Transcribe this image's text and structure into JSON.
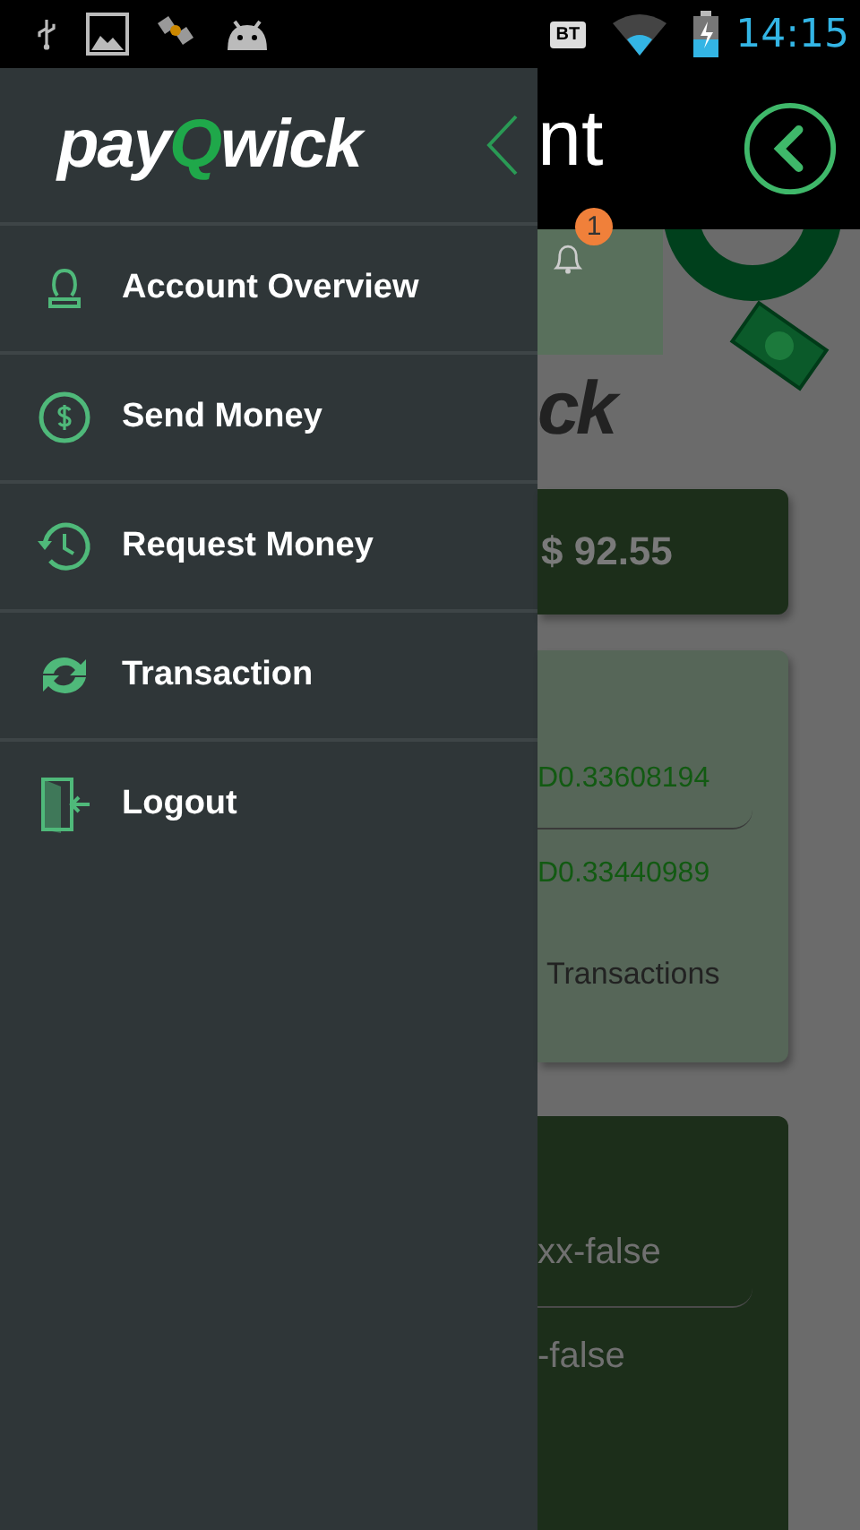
{
  "status_bar": {
    "bt": "BT",
    "time": "14:15"
  },
  "drawer": {
    "logo": [
      {
        "text": "pay",
        "accent": false
      },
      {
        "text": "Q",
        "accent": true
      },
      {
        "text": "wick",
        "accent": false
      }
    ],
    "items": [
      {
        "label": "Account Overview",
        "kind": "person"
      },
      {
        "label": "Send Money",
        "kind": "dollar"
      },
      {
        "label": "Request Money",
        "kind": "history"
      },
      {
        "label": "Transaction",
        "kind": "refresh"
      },
      {
        "label": "Logout",
        "kind": "door"
      }
    ]
  },
  "page": {
    "title": "nt",
    "notification_count": "1",
    "logo_fragment": "ck",
    "balance": "$ 92.55",
    "rates": [
      "D0.33608194",
      "D0.33440989"
    ],
    "transactions_link": "Transactions",
    "account_lines": [
      "xx-false",
      "-false"
    ]
  }
}
